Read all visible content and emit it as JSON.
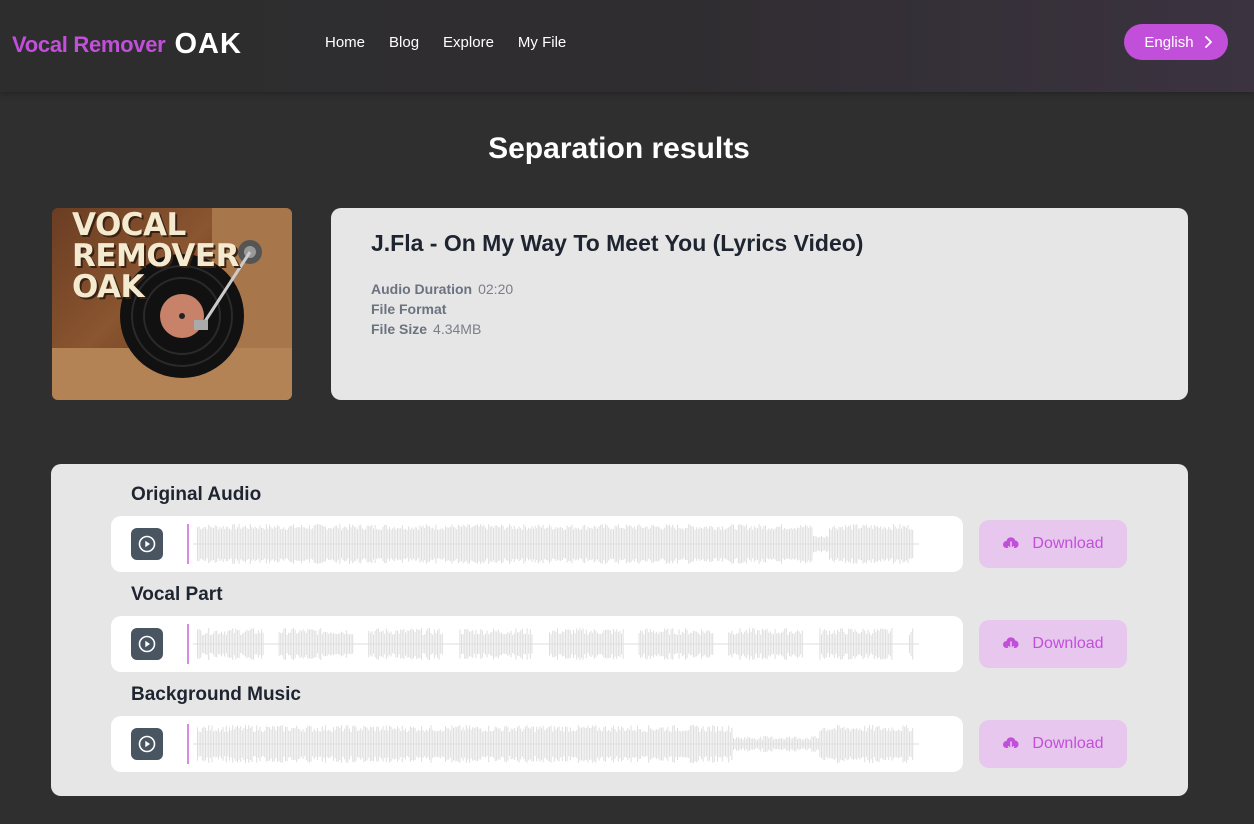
{
  "header": {
    "logo_text": "Vocal Remover",
    "logo_oak": "OAK",
    "nav": [
      "Home",
      "Blog",
      "Explore",
      "My File"
    ],
    "language": "English"
  },
  "page_title": "Separation results",
  "cover": {
    "text_line1": "VOCAL",
    "text_line2": "REMOVER",
    "text_line3": "OAK"
  },
  "file": {
    "title": "J.Fla - On My Way To Meet You (Lyrics Video)",
    "duration_label": "Audio Duration",
    "duration": "02:20",
    "format_label": "File Format",
    "format": "",
    "size_label": "File Size",
    "size": "4.34MB"
  },
  "tracks": [
    {
      "label": "Original Audio",
      "download": "Download"
    },
    {
      "label": "Vocal Part",
      "download": "Download"
    },
    {
      "label": "Background Music",
      "download": "Download"
    }
  ],
  "colors": {
    "accent": "#c14fd9",
    "background": "#2f2f2f",
    "card": "#e6e6e6",
    "download_bg": "#e7c7ee",
    "waveform": "#dedede"
  }
}
